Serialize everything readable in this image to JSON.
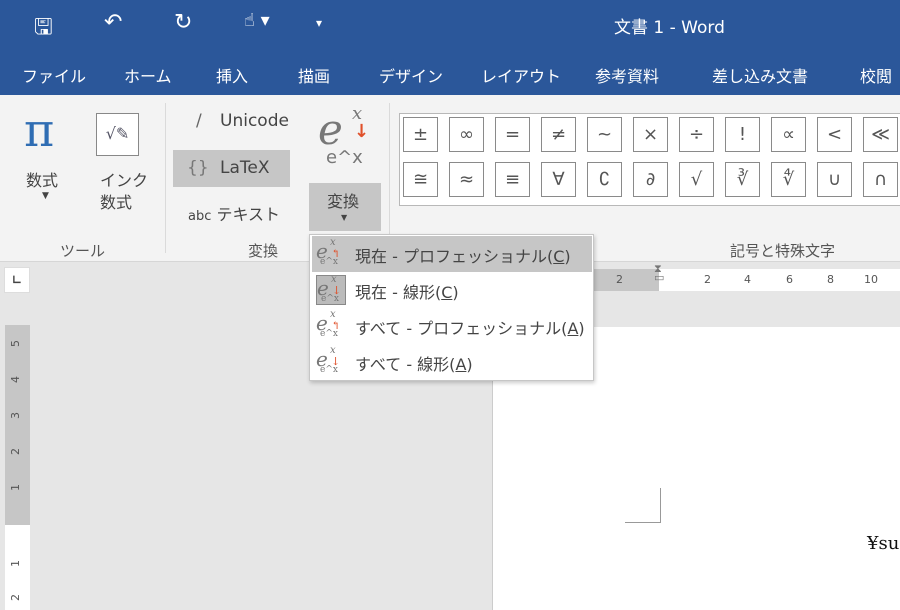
{
  "window": {
    "title": "文書 1  -  Word"
  },
  "quick_access": {
    "save": "save-icon",
    "undo": "undo-icon",
    "redo": "redo-icon",
    "touch": "touch-mode-icon",
    "customize": "customize-icon"
  },
  "tabs": [
    "ファイル",
    "ホーム",
    "挿入",
    "描画",
    "デザイン",
    "レイアウト",
    "参考資料",
    "差し込み文書",
    "校閲"
  ],
  "ribbon": {
    "tools_group": {
      "label": "ツール",
      "equation": "数式",
      "ink_equation_line1": "インク",
      "ink_equation_line2": "数式"
    },
    "convert_group": {
      "label": "変換",
      "unicode": "Unicode",
      "latex": "LaTeX",
      "text_prefix": "abc",
      "text": "テキスト",
      "convert": "変換",
      "unicode_glyph": "/",
      "latex_glyph": "{}"
    },
    "symbols_group": {
      "label": "記号と特殊文字",
      "row1": [
        "±",
        "∞",
        "=",
        "≠",
        "~",
        "×",
        "÷",
        "!",
        "∝",
        "<",
        "≪"
      ],
      "row2": [
        "≅",
        "≈",
        "≡",
        "∀",
        "∁",
        "∂",
        "√",
        "∛",
        "∜",
        "∪",
        "∩"
      ]
    }
  },
  "dropdown": {
    "items": [
      {
        "pre": "現在 - プロフェッショナル(",
        "key": "C",
        "post": ")"
      },
      {
        "pre": "現在 - 線形(",
        "key": "C",
        "post": ")"
      },
      {
        "pre": "すべて - プロフェッショナル(",
        "key": "A",
        "post": ")"
      },
      {
        "pre": "すべて - 線形(",
        "key": "A",
        "post": ")"
      }
    ]
  },
  "ruler": {
    "h_ticks": [
      "2",
      "",
      "2",
      "4",
      "6",
      "8",
      "10"
    ],
    "v_ticks": [
      "5",
      "4",
      "3",
      "2",
      "1",
      "1",
      "2"
    ]
  },
  "document": {
    "text": "¥su"
  }
}
